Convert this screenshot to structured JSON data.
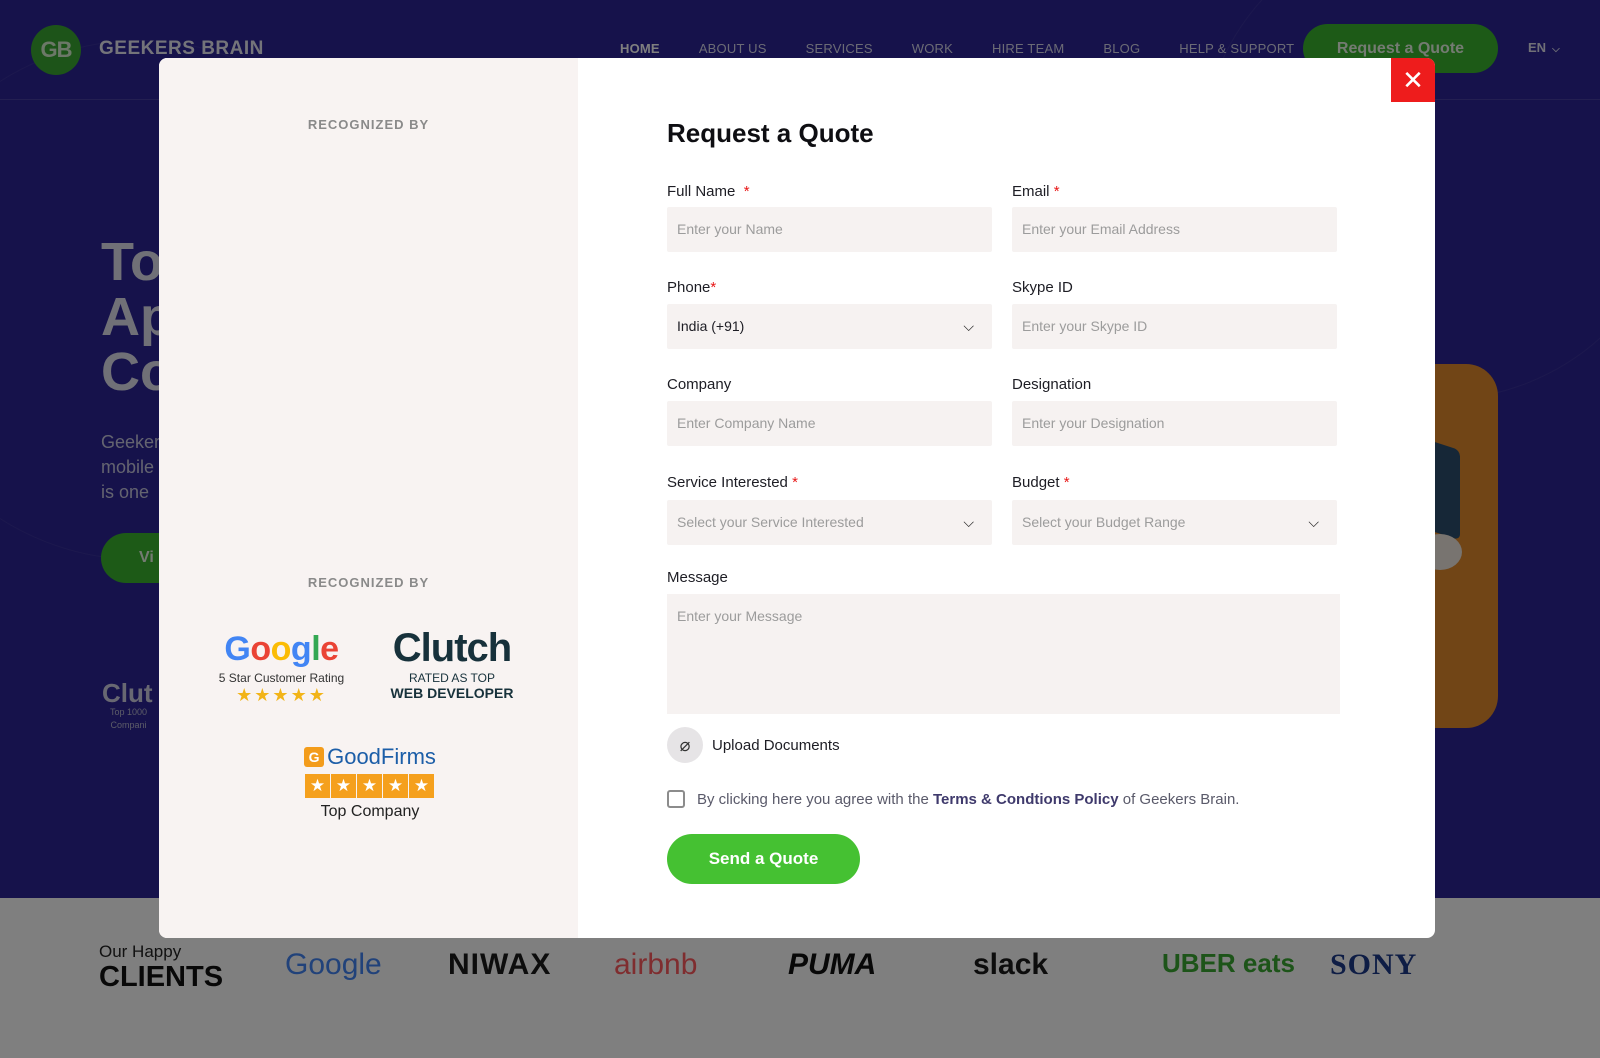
{
  "site": {
    "logo_badge": "GB",
    "logo_text": "GEEKERS BRAIN",
    "nav": [
      {
        "label": "HOME",
        "active": true
      },
      {
        "label": "ABOUT US"
      },
      {
        "label": "SERVICES"
      },
      {
        "label": "WORK"
      },
      {
        "label": "HIRE TEAM"
      },
      {
        "label": "BLOG"
      },
      {
        "label": "HELP & SUPPORT"
      }
    ],
    "cta_label": "Request a Quote",
    "language": "EN"
  },
  "hero": {
    "title_lines": [
      "To",
      "Ap",
      "Co"
    ],
    "paragraph_lines": [
      "Geeker",
      "mobile",
      "is one"
    ],
    "button_label": "Vi",
    "clutch_text": "Clut",
    "clutch_sub": [
      "Top 1000",
      "Compani"
    ]
  },
  "clients": {
    "heading_small": "Our Happy",
    "heading_big": "CLIENTS",
    "logos": [
      "Google",
      "NIWAX",
      "airbnb",
      "PUMA",
      "slack",
      "UBER eats",
      "SONY"
    ]
  },
  "modal": {
    "recognized_top": "RECOGNIZED BY",
    "recognized_bottom": "RECOGNIZED BY",
    "google_badge": {
      "text": "5 Star Customer Rating",
      "stars": "★★★★★"
    },
    "clutch_badge": {
      "logo": "Clutch",
      "line1": "RATED AS TOP",
      "line2": "WEB DEVELOPER"
    },
    "goodfirms_badge": {
      "logo": "GoodFirms",
      "text": "Top Company"
    },
    "close_symbol": "✕",
    "title": "Request a Quote",
    "fields": {
      "full_name": {
        "label": "Full Name",
        "required": "*",
        "placeholder": "Enter your Name"
      },
      "email": {
        "label": "Email",
        "required": "*",
        "placeholder": "Enter your Email Address"
      },
      "phone": {
        "label": "Phone",
        "required": "*",
        "value": "India (+91)"
      },
      "skype": {
        "label": "Skype ID",
        "placeholder": "Enter your Skype ID"
      },
      "company": {
        "label": "Company",
        "placeholder": "Enter Company Name"
      },
      "designation": {
        "label": "Designation",
        "placeholder": "Enter your Designation"
      },
      "service": {
        "label": "Service Interested",
        "required": "*",
        "placeholder": "Select your Service Interested"
      },
      "budget": {
        "label": "Budget",
        "required": "*",
        "placeholder": "Select your Budget Range"
      },
      "message": {
        "label": "Message",
        "placeholder": "Enter your Message"
      }
    },
    "upload_label": "Upload Documents",
    "agree": {
      "before": "By clicking here you agree with the ",
      "link": "Terms & Condtions Policy",
      "after": " of Geekers Brain."
    },
    "send_label": "Send a Quote"
  },
  "colors": {
    "hero_bg": "#2d2596",
    "accent_green": "#45c132",
    "close_red": "#ee1c1c",
    "panel_bg": "#f8f3f2"
  }
}
